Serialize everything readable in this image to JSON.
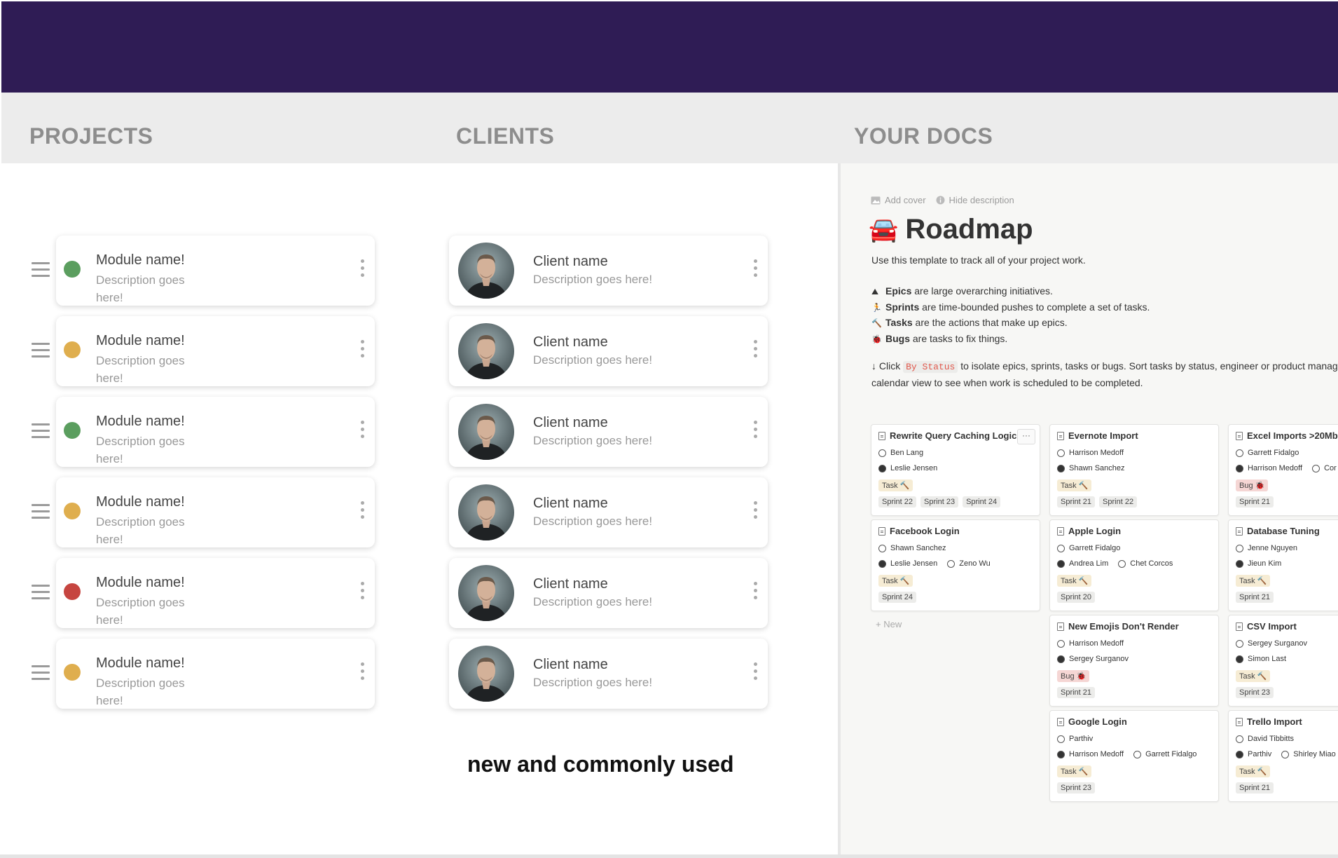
{
  "sections": {
    "projects": "PROJECTS",
    "clients": "CLIENTS",
    "docs": "YOUR DOCS"
  },
  "projects": [
    {
      "name": "Module name!",
      "description": "Description goes here!",
      "status": "green"
    },
    {
      "name": "Module name!",
      "description": "Description goes here!",
      "status": "yellow"
    },
    {
      "name": "Module name!",
      "description": "Description goes here!",
      "status": "green"
    },
    {
      "name": "Module name!",
      "description": "Description goes here!",
      "status": "yellow"
    },
    {
      "name": "Module name!",
      "description": "Description goes here!",
      "status": "red"
    },
    {
      "name": "Module name!",
      "description": "Description goes here!",
      "status": "yellow"
    }
  ],
  "status_colors": {
    "green": "#5b9e5f",
    "yellow": "#dfae4e",
    "red": "#c64540"
  },
  "clients": [
    {
      "name": "Client name",
      "description": "Description goes here!"
    },
    {
      "name": "Client name",
      "description": "Description goes here!"
    },
    {
      "name": "Client name",
      "description": "Description goes here!"
    },
    {
      "name": "Client name",
      "description": "Description goes here!"
    },
    {
      "name": "Client name",
      "description": "Description goes here!"
    },
    {
      "name": "Client name",
      "description": "Description goes here!"
    }
  ],
  "caption": "new and commonly used",
  "doc": {
    "add_cover": "Add cover",
    "hide_description": "Hide description",
    "icon": "🚘",
    "title": "Roadmap",
    "intro": "Use this template to track all of your project work.",
    "legend": [
      {
        "icon": "⛰",
        "term": "Epics",
        "text": " are large overarching initiatives."
      },
      {
        "icon": "🏃",
        "term": "Sprints",
        "text": " are time-bounded pushes to complete a set of tasks."
      },
      {
        "icon": "🔨",
        "term": "Tasks",
        "text": " are the actions that make up epics."
      },
      {
        "icon": "🐞",
        "term": "Bugs",
        "text": " are tasks to fix things."
      }
    ],
    "click_prefix": "↓ Click ",
    "click_code": "By Status",
    "click_suffix": " to isolate epics, sprints, tasks or bugs. Sort tasks by status, engineer or product manag",
    "click_line2": "calendar view to see when work is scheduled to be completed.",
    "new_label": "+ New",
    "more_label": "···"
  },
  "board": [
    {
      "title": "Rewrite Query Caching Logic",
      "people": [
        [
          "Ben Lang"
        ],
        [
          "Leslie Jensen"
        ]
      ],
      "tags": [
        [
          "Task 🔨"
        ],
        [
          "Sprint 22",
          "Sprint 23",
          "Sprint 24"
        ]
      ]
    },
    {
      "title": "Facebook Login",
      "people": [
        [
          "Shawn Sanchez"
        ],
        [
          "Leslie Jensen",
          "Zeno Wu"
        ]
      ],
      "tags": [
        [
          "Task 🔨"
        ],
        [
          "Sprint 24"
        ]
      ]
    },
    {
      "title": "Evernote Import",
      "people": [
        [
          "Harrison Medoff"
        ],
        [
          "Shawn Sanchez"
        ]
      ],
      "tags": [
        [
          "Task 🔨"
        ],
        [
          "Sprint 21",
          "Sprint 22"
        ]
      ]
    },
    {
      "title": "Apple Login",
      "people": [
        [
          "Garrett Fidalgo"
        ],
        [
          "Andrea Lim",
          "Chet Corcos"
        ]
      ],
      "tags": [
        [
          "Task 🔨"
        ],
        [
          "Sprint 20"
        ]
      ]
    },
    {
      "title": "New Emojis Don't Render",
      "people": [
        [
          "Harrison Medoff"
        ],
        [
          "Sergey Surganov"
        ]
      ],
      "tags": [
        [
          "Bug 🐞"
        ],
        [
          "Sprint 21"
        ]
      ]
    },
    {
      "title": "Google Login",
      "people": [
        [
          "Parthiv"
        ],
        [
          "Harrison Medoff",
          "Garrett Fidalgo"
        ]
      ],
      "tags": [
        [
          "Task 🔨"
        ],
        [
          "Sprint 23"
        ]
      ]
    },
    {
      "title": "Excel Imports >20Mb",
      "people": [
        [
          "Garrett Fidalgo"
        ],
        [
          "Harrison Medoff",
          "Cor"
        ]
      ],
      "tags": [
        [
          "Bug 🐞"
        ],
        [
          "Sprint 21"
        ]
      ]
    },
    {
      "title": "Database Tuning",
      "people": [
        [
          "Jenne Nguyen"
        ],
        [
          "Jieun Kim"
        ]
      ],
      "tags": [
        [
          "Task 🔨"
        ],
        [
          "Sprint 21"
        ]
      ]
    },
    {
      "title": "CSV Import",
      "people": [
        [
          "Sergey Surganov"
        ],
        [
          "Simon Last"
        ]
      ],
      "tags": [
        [
          "Task 🔨"
        ],
        [
          "Sprint 23"
        ]
      ]
    },
    {
      "title": "Trello Import",
      "people": [
        [
          "David Tibbitts"
        ],
        [
          "Parthiv",
          "Shirley Miao"
        ]
      ],
      "tags": [
        [
          "Task 🔨"
        ],
        [
          "Sprint 21"
        ]
      ]
    }
  ]
}
